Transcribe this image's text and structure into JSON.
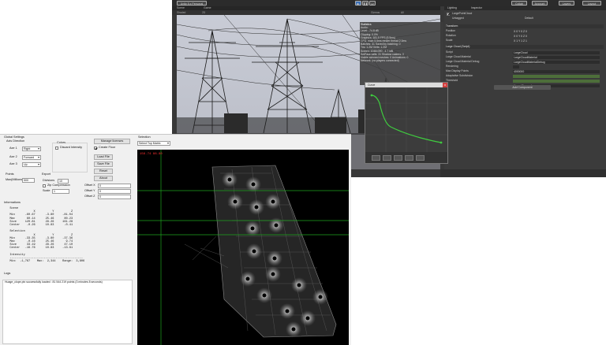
{
  "unity": {
    "title_tab": "Unity 5.x Personal",
    "toolbar": {
      "collab": "Collab",
      "account": "Account",
      "layers": "Layers",
      "layout": "Layout"
    },
    "scene_tabs": [
      "Scene",
      "Game"
    ],
    "scene_bar": {
      "shaded": "Shaded",
      "mode": "2D",
      "gizmos": "Gizmos",
      "search": "All"
    },
    "stats": {
      "title": "Statistics",
      "lines": [
        "Audio:",
        "Level: -74.8 dB",
        "Clipping: 0.0%",
        "Graphics: 181.5 FPS (5.5ms)",
        "CPU: main 5.5ms render thread 2.0ms",
        "Batches: 31 Saved by batching: 0",
        "Tris: 1.2M Verts: 1.0M",
        "Screen: 1046x390 - 4.7 MB",
        "SetPass calls: 31 Shadow casters: 0",
        "Visible skinned meshes: 0 Animations: 0",
        "Network: (no players connected)"
      ]
    },
    "right_tabs": [
      "Lighting",
      "Inspector"
    ],
    "inspector": {
      "object": "LargePointCloud",
      "tag": "Untagged",
      "layer": "Default",
      "transform": "Transform",
      "position": "Position",
      "rotation": "Rotation",
      "scale": "Scale",
      "xyz_pos": "X 0   Y 0   Z 0",
      "xyz_rot": "X 0   Y 0   Z 0",
      "xyz_scl": "X 1   Y 1   Z 1",
      "script": "Large Cloud (Script)",
      "rows": [
        {
          "k": "Script",
          "v": "LargeCloud"
        },
        {
          "k": "Large Cloud Material",
          "v": "LargeCloudMaterial"
        },
        {
          "k": "Large Cloud Material Debug",
          "v": "LargeCloudMaterialDebug"
        },
        {
          "k": "Rendering",
          "v": ""
        },
        {
          "k": "Max Display Points",
          "v": "4000000"
        },
        {
          "k": "Adaptative Subdivision",
          "v": ""
        },
        {
          "k": "Threshold",
          "v": ""
        },
        {
          "k": "",
          "v": "None (Camera)"
        }
      ],
      "add_component": "Add Component"
    },
    "curve": {
      "title": "Curve",
      "close": "x"
    }
  },
  "app": {
    "global_settings": "Global Settings",
    "axis_direction": "Axis Direction",
    "axes": [
      {
        "label": "Axe 1",
        "value": "Right"
      },
      {
        "label": "Axe 2",
        "value": "Forward"
      },
      {
        "label": "Axe 3",
        "value": "Up"
      }
    ],
    "colors": "Colors",
    "discard_intensity": "Discard Intensity",
    "manage_licenses": "Manage licenses",
    "create_floor": "Create Floor",
    "load_file": "Load File",
    "save_file": "Save File",
    "reset": "Reset",
    "about": "About",
    "points": "Points",
    "max_millions_label": "Max(Millions)",
    "max_millions": "500",
    "export": "Export",
    "divisions_label": "Divisions",
    "divisions": "10",
    "zip_compression": "Zip Compression",
    "scale_label": "Scale",
    "scale": "1",
    "offset_x_label": "Offset X",
    "offset_x": "0",
    "offset_y_label": "Offset Y",
    "offset_y": "0",
    "offset_z_label": "Offset Z",
    "offset_z": "0",
    "informations": "Informations",
    "info_text": "  Scene\n                X          Y          Z\n  Min      -60.67      -3.80     -81.04\n  Max       60.14      25.46      80.23\n  Size     120.81      29.26     161.28\n  Center    -0.26      10.83      -0.41\n\n  Selection\n                X          Y          Z\n  Min      -33.35      -3.80     -37.36\n  Max       -0.16      25.46       9.74\n  Size      33.19      29.26      47.10\n  Center   -16.76      10.83     -13.81\n\n  Intensity\n  -------------------------------------------\n  Min:  -1,767    Max:  2,344    Range:  3,806",
    "logs": "Logs",
    "log_lines": [
      "Huage_clope.ptx successfully loaded : 81 544 219 points (3 minutes 8 seconds)"
    ],
    "selection": "Selection",
    "selection_mode": "Select Top Matrix",
    "view_readout": "156.74 88.80"
  },
  "colors": {
    "unity_bg": "#383838",
    "accent_blue": "#3c6fb5",
    "curve_green": "#3fcc3f",
    "grid_green": "#1ea51e",
    "readout_red": "#ff3030"
  }
}
